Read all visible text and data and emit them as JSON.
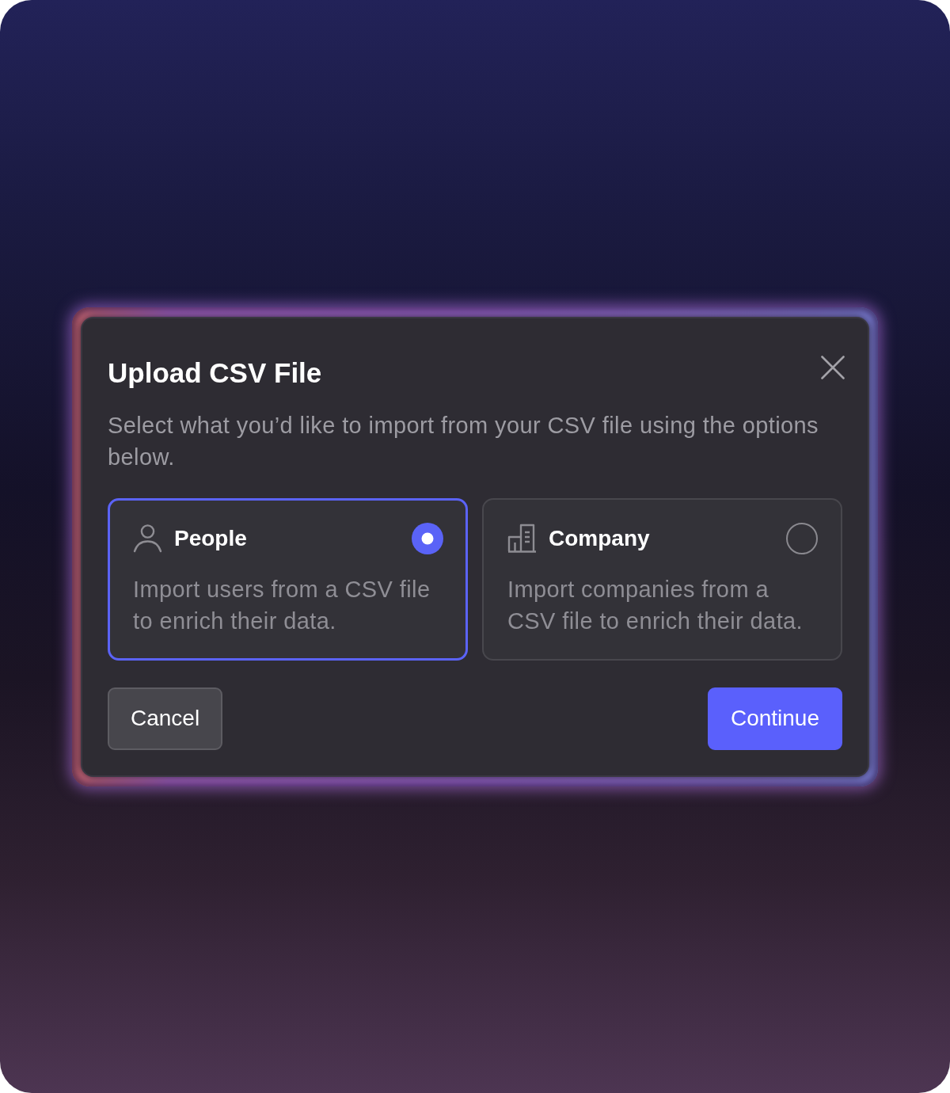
{
  "dialog": {
    "title": "Upload CSV File",
    "description": "Select what you’d like to import from your CSV file using the options below.",
    "options": [
      {
        "kind": "person",
        "title": "People",
        "description": "Import users from a CSV file to enrich their data.",
        "selected": true
      },
      {
        "kind": "building",
        "title": "Company",
        "description": "Import companies from a CSV file to enrich their data.",
        "selected": false
      }
    ],
    "buttons": [
      {
        "kind": "secondary",
        "label": "Cancel"
      },
      {
        "kind": "primary",
        "label": "Continue"
      }
    ]
  }
}
